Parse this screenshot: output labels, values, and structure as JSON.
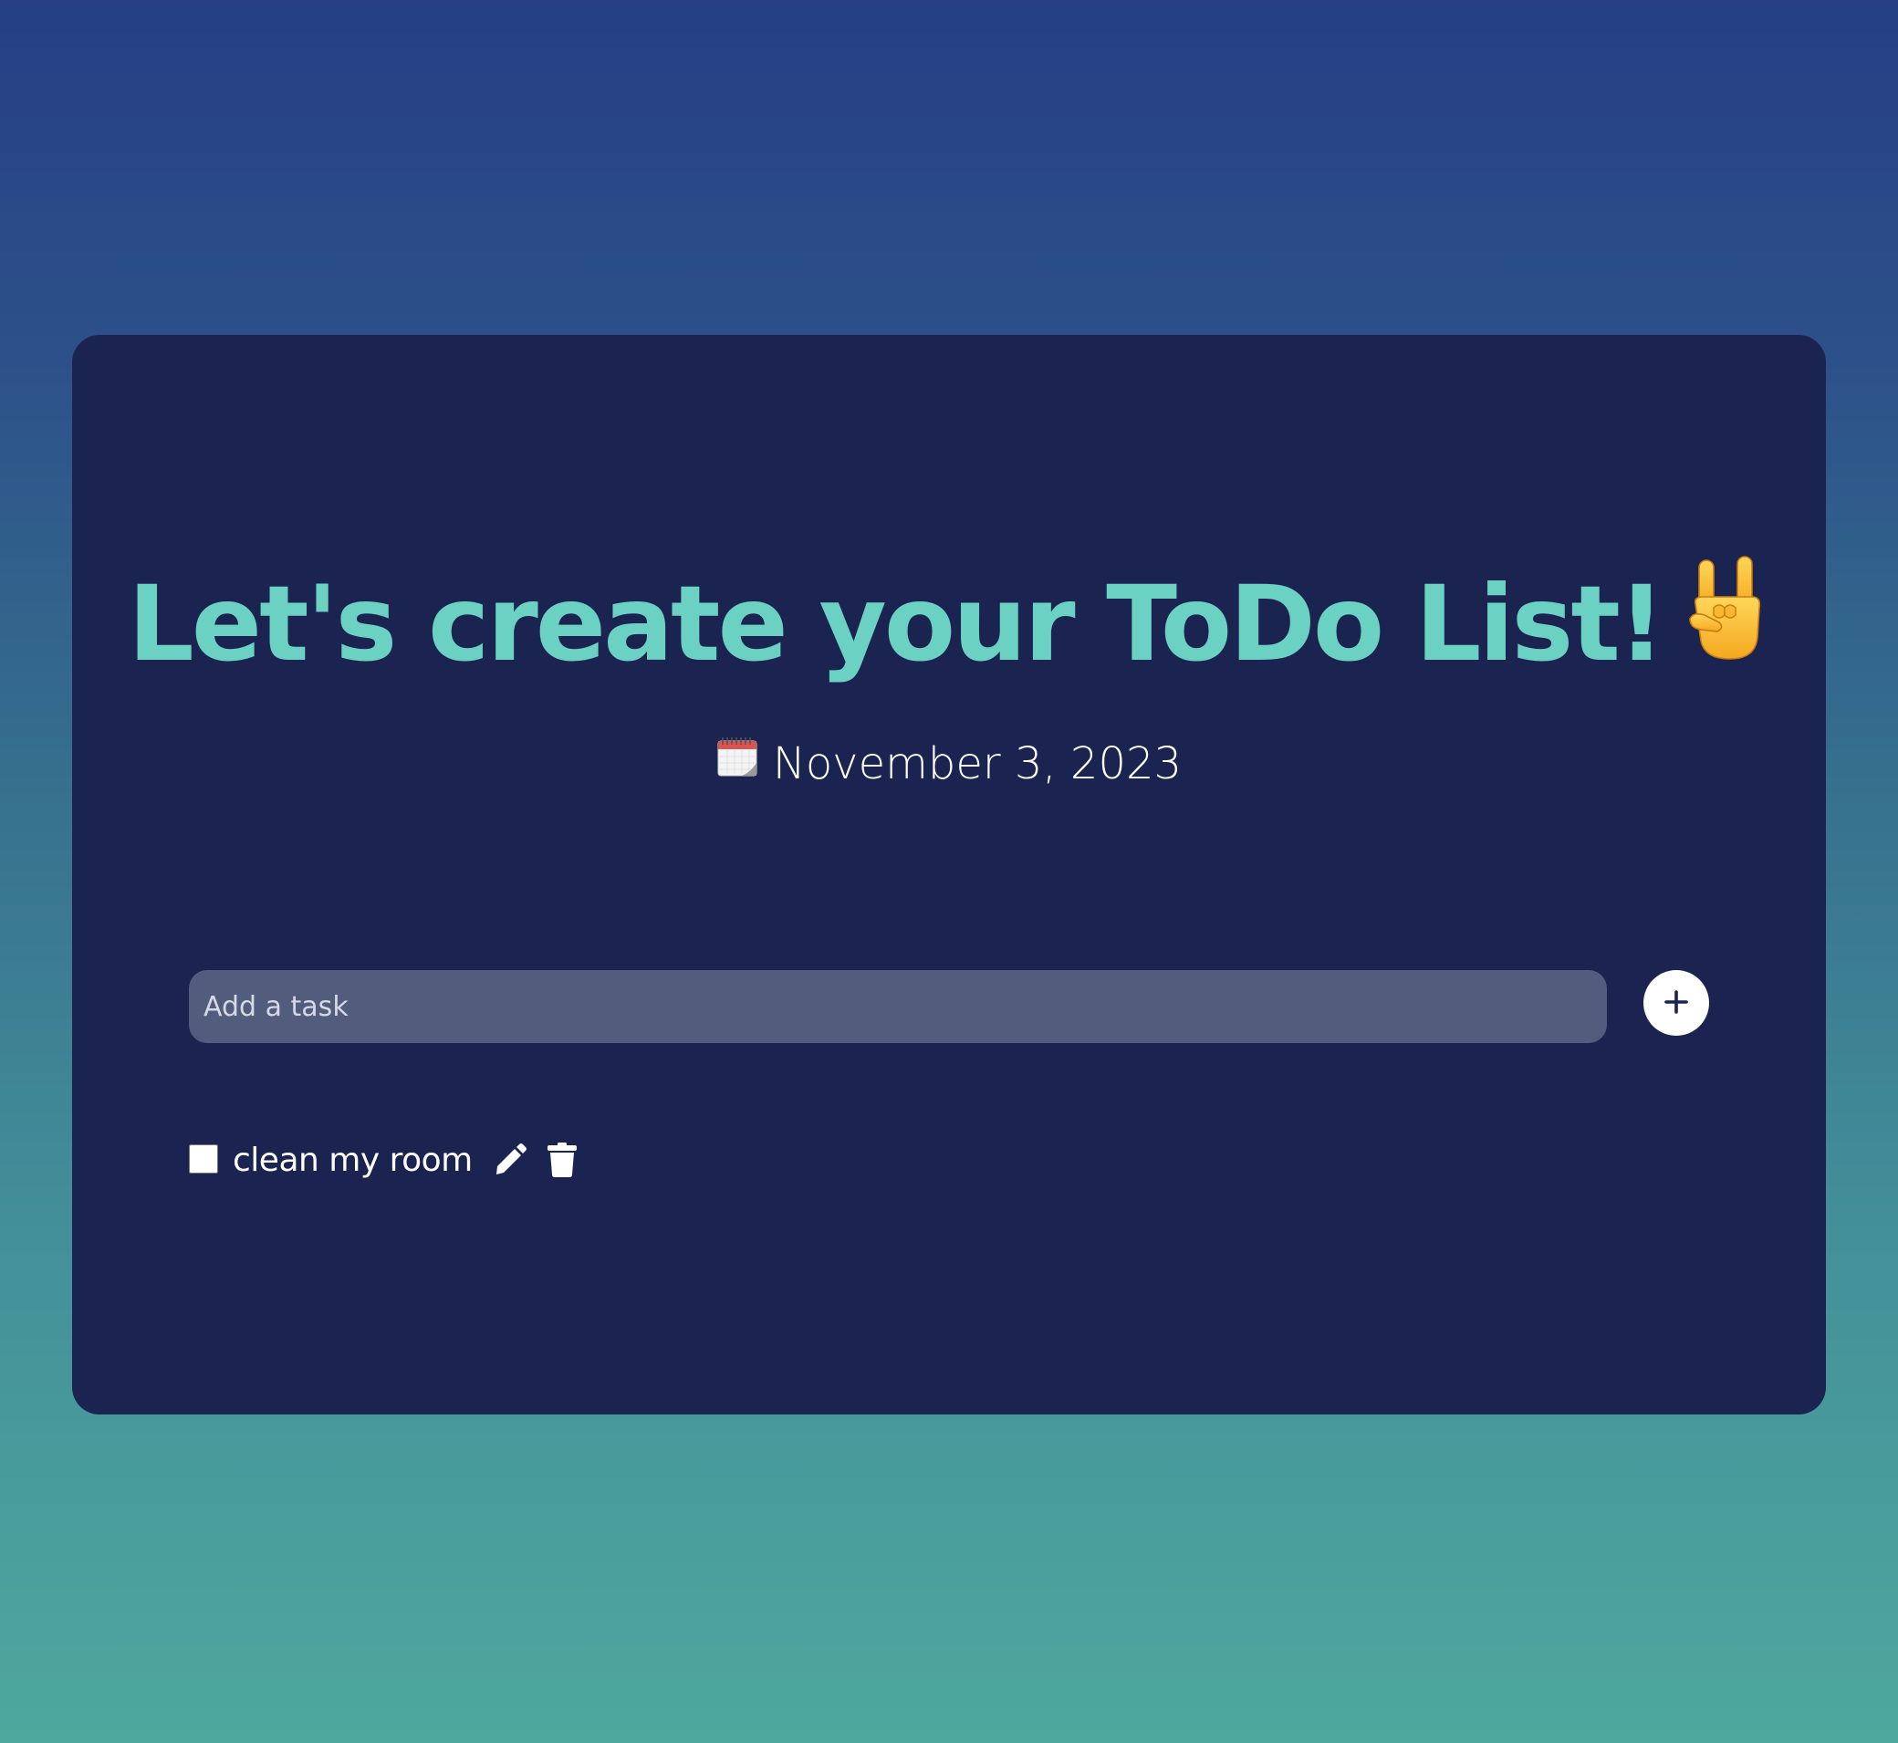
{
  "header": {
    "title": "Let's create your ToDo List!",
    "title_emoji_icon": "rock-on-hand-icon",
    "date_icon": "calendar-icon",
    "date": "November 3, 2023"
  },
  "new_task": {
    "placeholder": "Add a task",
    "value": "",
    "add_button_icon": "plus-icon"
  },
  "tasks": [
    {
      "label": "clean my room",
      "completed": false,
      "edit_icon": "pencil-icon",
      "delete_icon": "trash-icon"
    }
  ],
  "colors": {
    "background_top": "#263f85",
    "background_bottom": "#4ea89e",
    "card": "#1b2451",
    "title": "#6bd1c2",
    "input": "#525c7d",
    "text": "#ffffff"
  }
}
